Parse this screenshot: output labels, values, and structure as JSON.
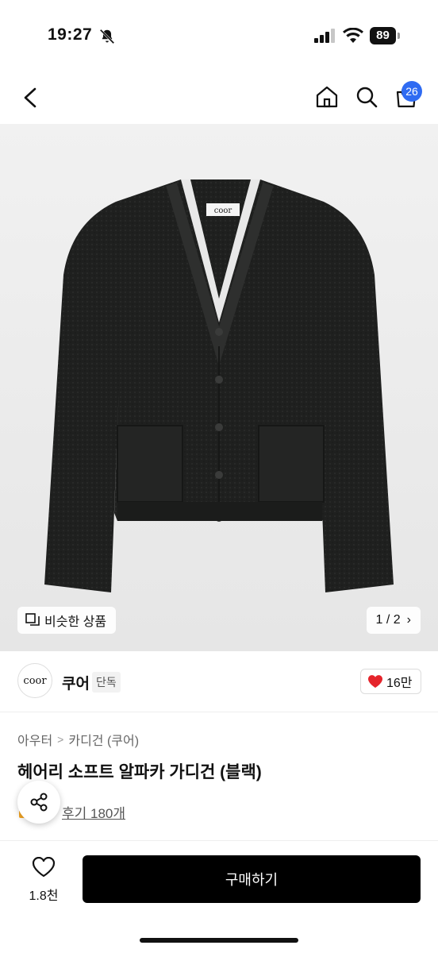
{
  "status": {
    "time": "19:27",
    "battery": "89"
  },
  "nav": {
    "cart_count": "26"
  },
  "image": {
    "logo_label": "coor",
    "similar_label": "비슷한 상품",
    "pager": "1 / 2",
    "pager_chevron": "›"
  },
  "brand": {
    "logo_text": "coor",
    "name": "쿠어",
    "tag": "단독",
    "likes": "16만"
  },
  "breadcrumb": {
    "items": [
      "아우터",
      "카디건 (쿠어)"
    ],
    "separator": ">"
  },
  "product": {
    "title": "헤어리 소프트 알파카 가디건 (블랙)",
    "reviews": "후기 180개"
  },
  "bottom": {
    "wish_count": "1.8천",
    "buy_label": "구매하기"
  },
  "colors": {
    "accent": "#2f6bf2",
    "heart": "#e5242b",
    "buy_bg": "#000000",
    "garment": "#1e1f1e"
  },
  "icons": [
    "bell-slash-icon",
    "signal-icon",
    "wifi-icon",
    "battery-icon",
    "back-icon",
    "home-icon",
    "search-icon",
    "cart-icon",
    "similar-icon",
    "heart-icon",
    "share-icon",
    "heart-outline-icon"
  ]
}
